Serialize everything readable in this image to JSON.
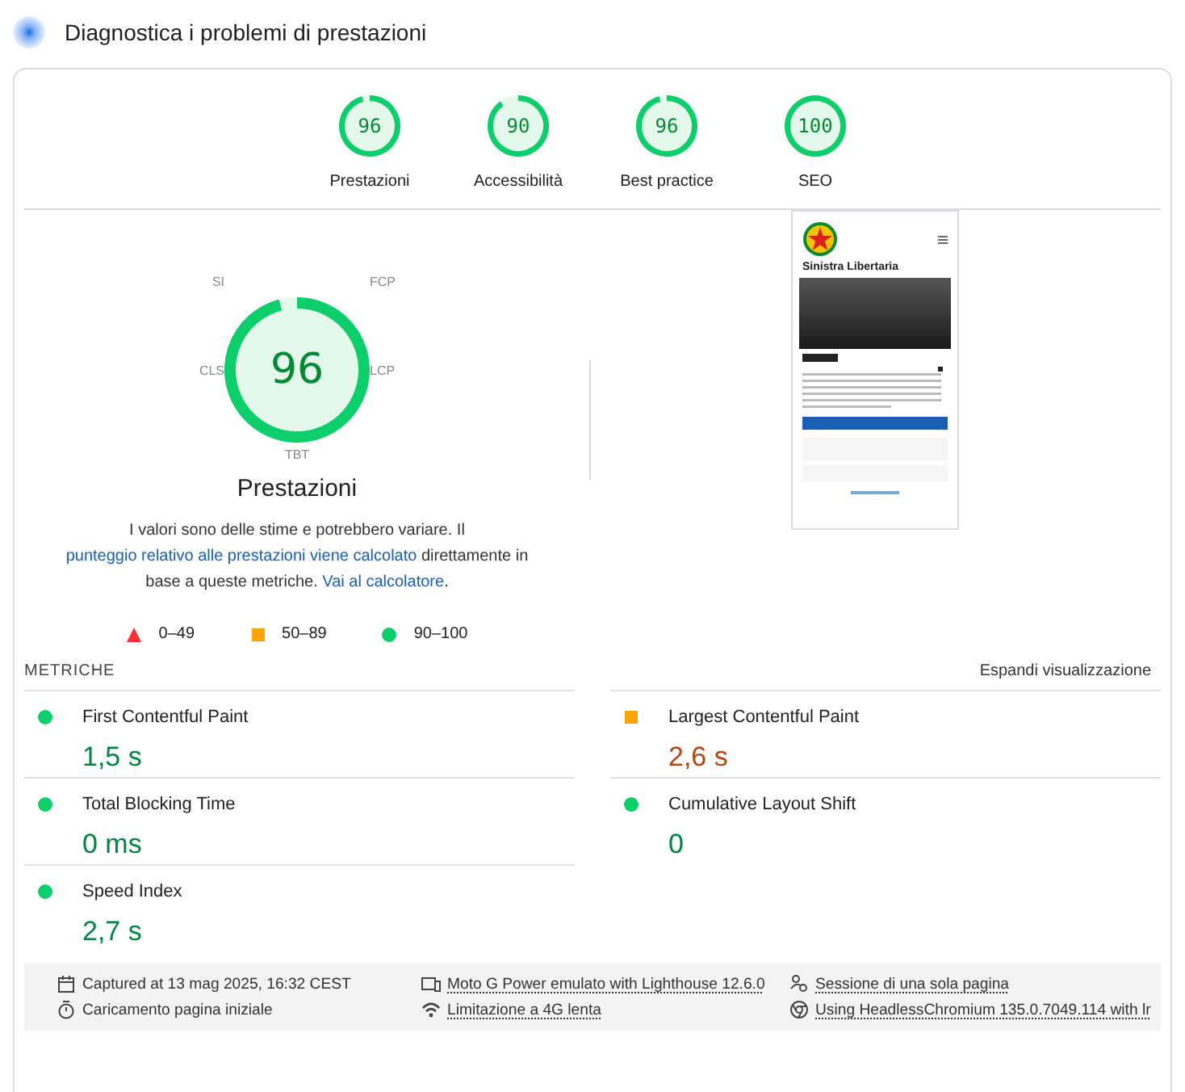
{
  "header": {
    "title": "Diagnostica i problemi di prestazioni"
  },
  "categories": [
    {
      "score": "96",
      "level": 0.96,
      "label": "Prestazioni"
    },
    {
      "score": "90",
      "level": 0.9,
      "label": "Accessibilità"
    },
    {
      "score": "96",
      "level": 0.96,
      "label": "Best practice"
    },
    {
      "score": "100",
      "level": 1.0,
      "label": "SEO"
    }
  ],
  "performance": {
    "score": "96",
    "level": 0.96,
    "title": "Prestazioni",
    "gauge_labels": [
      "SI",
      "FCP",
      "LCP",
      "TBT",
      "CLS"
    ],
    "description": [
      {
        "text": "I valori sono delle stime e potrebbero variare. Il ",
        "link": false
      },
      {
        "text": "punteggio relativo alle prestazioni viene calcolato",
        "link": true
      },
      {
        "text": " direttamente in base a queste metriche. ",
        "link": false
      },
      {
        "text": "Vai al calcolatore",
        "link": true
      },
      {
        "text": ".",
        "link": false
      }
    ],
    "legend": [
      {
        "kind": "fail",
        "label": "0–49"
      },
      {
        "kind": "average",
        "label": "50–89"
      },
      {
        "kind": "pass",
        "label": "90–100"
      }
    ],
    "screenshot": {
      "site_title": "Sinistra Libertaria"
    }
  },
  "metrics": {
    "title": "METRICHE",
    "toggle": "Espandi visualizzazione",
    "items": [
      {
        "name": "First Contentful Paint",
        "value": "1,5 s",
        "kind": "pass"
      },
      {
        "name": "Largest Contentful Paint",
        "value": "2,6 s",
        "kind": "average"
      },
      {
        "name": "Total Blocking Time",
        "value": "0 ms",
        "kind": "pass"
      },
      {
        "name": "Cumulative Layout Shift",
        "value": "0",
        "kind": "pass"
      },
      {
        "name": "Speed Index",
        "value": "2,7 s",
        "kind": "pass"
      }
    ]
  },
  "footer": [
    {
      "text": "Captured at 13 mag 2025, 16:32 CEST",
      "link": false
    },
    {
      "text": "Moto G Power emulato with Lighthouse 12.6.0",
      "link": true
    },
    {
      "text": "Sessione di una sola pagina",
      "link": true
    },
    {
      "text": "Caricamento pagina iniziale",
      "link": false
    },
    {
      "text": "Limitazione a 4G lenta",
      "link": true
    },
    {
      "text": "Using HeadlessChromium 135.0.7049.114 with lr",
      "link": true
    }
  ]
}
